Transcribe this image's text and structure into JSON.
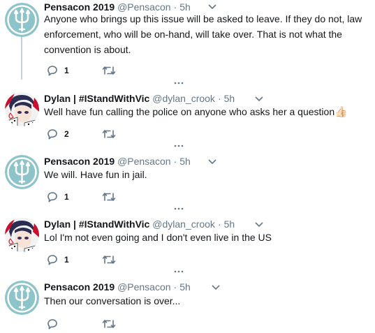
{
  "tweets": [
    {
      "author": "Pensacon 2019",
      "handle": "@Pensacon",
      "time": "5h",
      "text": "Anyone who brings up this issue will be asked to leave. If they do not, law enforcement, who will be on-hand, will take over. That is not what the convention is about.",
      "replies": "1",
      "avatar": "trident-avatar"
    },
    {
      "author": "Dylan | #IStandWithVic",
      "handle": "@dylan_crook",
      "time": "5h",
      "text": "Well have fun calling the police on anyone who asks her a question",
      "emoji": "👍🏻",
      "replies": "2",
      "avatar": "anime-avatar"
    },
    {
      "author": "Pensacon 2019",
      "handle": "@Pensacon",
      "time": "5h",
      "text": "We will. Have fun in jail.",
      "replies": "1",
      "avatar": "trident-avatar"
    },
    {
      "author": "Dylan | #IStandWithVic",
      "handle": "@dylan_crook",
      "time": "5h",
      "text": "Lol I'm not even going and I don't even live in the US",
      "replies": "1",
      "avatar": "anime-avatar"
    },
    {
      "author": "Pensacon 2019",
      "handle": "@Pensacon",
      "time": "5h",
      "text": "Then our conversation is over...",
      "replies": "",
      "avatar": "trident-avatar"
    }
  ],
  "colors": {
    "text": "#14171a",
    "secondary": "#657786",
    "thread_line": "#c4cfd6",
    "trident_bg": "#8cc4c9",
    "trident_ring": "#ffffff"
  },
  "icons": [
    "reply-icon",
    "retweet-icon",
    "chevron-down-icon",
    "more-dots-icon"
  ]
}
